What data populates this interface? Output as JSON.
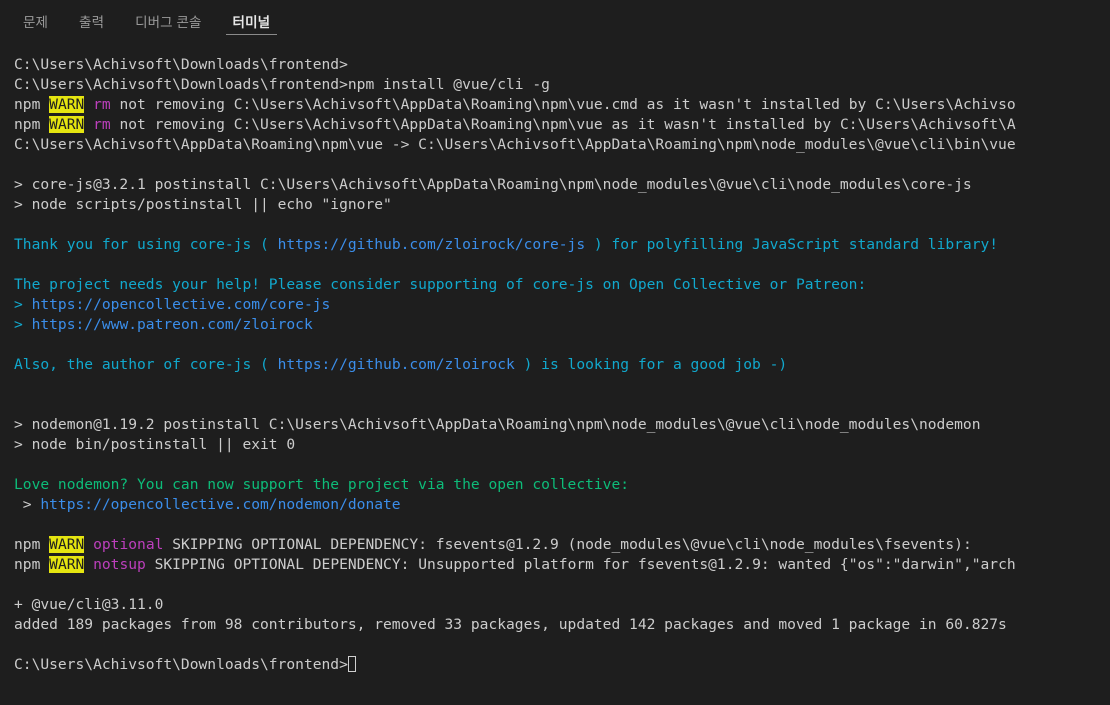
{
  "panel": {
    "tabs": [
      {
        "label": "문제",
        "active": false
      },
      {
        "label": "출력",
        "active": false
      },
      {
        "label": "디버그 콘솔",
        "active": false
      },
      {
        "label": "터미널",
        "active": true
      }
    ]
  },
  "colors": {
    "background": "#1e1e1e",
    "foreground": "#cccccc",
    "cyan": "#11a8cd",
    "blue": "#3b8eea",
    "green": "#0dbc79",
    "magenta": "#bc3fbc",
    "warn_background": "#e5e510",
    "warn_foreground": "#1e1e1e",
    "tab_active": "#e7e7e7",
    "tab_inactive": "#9a9a9a"
  },
  "terminal": {
    "prompt": "C:\\Users\\Achivsoft\\Downloads\\frontend>",
    "command": "npm install @vue/cli -g",
    "cursor": "block-outline",
    "lines": [
      {
        "id": "l00",
        "type": "blank"
      },
      {
        "id": "l01",
        "segments": [
          {
            "text": "C:\\Users\\Achivsoft\\Downloads\\frontend>",
            "style": "default"
          }
        ]
      },
      {
        "id": "l02",
        "segments": [
          {
            "text": "C:\\Users\\Achivsoft\\Downloads\\frontend>npm install @vue/cli -g",
            "style": "default"
          }
        ]
      },
      {
        "id": "l03",
        "segments": [
          {
            "text": "npm ",
            "style": "default"
          },
          {
            "text": "WARN",
            "style": "warn"
          },
          {
            "text": " ",
            "style": "default"
          },
          {
            "text": "rm",
            "style": "magenta"
          },
          {
            "text": " not removing C:\\Users\\Achivsoft\\AppData\\Roaming\\npm\\vue.cmd as it wasn't installed by C:\\Users\\Achivso",
            "style": "default"
          }
        ]
      },
      {
        "id": "l04",
        "segments": [
          {
            "text": "npm ",
            "style": "default"
          },
          {
            "text": "WARN",
            "style": "warn"
          },
          {
            "text": " ",
            "style": "default"
          },
          {
            "text": "rm",
            "style": "magenta"
          },
          {
            "text": " not removing C:\\Users\\Achivsoft\\AppData\\Roaming\\npm\\vue as it wasn't installed by C:\\Users\\Achivsoft\\A",
            "style": "default"
          }
        ]
      },
      {
        "id": "l05",
        "segments": [
          {
            "text": "C:\\Users\\Achivsoft\\AppData\\Roaming\\npm\\vue -> C:\\Users\\Achivsoft\\AppData\\Roaming\\npm\\node_modules\\@vue\\cli\\bin\\vue",
            "style": "default"
          }
        ]
      },
      {
        "id": "l06",
        "type": "blank"
      },
      {
        "id": "l07",
        "segments": [
          {
            "text": "> core-js@3.2.1 postinstall C:\\Users\\Achivsoft\\AppData\\Roaming\\npm\\node_modules\\@vue\\cli\\node_modules\\core-js",
            "style": "default"
          }
        ]
      },
      {
        "id": "l08",
        "segments": [
          {
            "text": "> node scripts/postinstall || echo \"ignore\"",
            "style": "default"
          }
        ]
      },
      {
        "id": "l09",
        "type": "blank"
      },
      {
        "id": "l10",
        "segments": [
          {
            "text": "Thank you for using core-js ( ",
            "style": "cyan"
          },
          {
            "text": "https://github.com/zloirock/core-js",
            "style": "blue"
          },
          {
            "text": " ) for polyfilling JavaScript standard library!",
            "style": "cyan"
          }
        ]
      },
      {
        "id": "l11",
        "type": "blank"
      },
      {
        "id": "l12",
        "segments": [
          {
            "text": "The project needs your help! Please consider supporting of core-js on Open Collective or Patreon:",
            "style": "cyan"
          }
        ]
      },
      {
        "id": "l13",
        "segments": [
          {
            "text": "> ",
            "style": "cyan"
          },
          {
            "text": "https://opencollective.com/core-js",
            "style": "blue"
          }
        ]
      },
      {
        "id": "l14",
        "segments": [
          {
            "text": "> ",
            "style": "cyan"
          },
          {
            "text": "https://www.patreon.com/zloirock",
            "style": "blue"
          }
        ]
      },
      {
        "id": "l15",
        "type": "blank"
      },
      {
        "id": "l16",
        "segments": [
          {
            "text": "Also, the author of core-js ( ",
            "style": "cyan"
          },
          {
            "text": "https://github.com/zloirock",
            "style": "blue"
          },
          {
            "text": " ) is looking for a good job -)",
            "style": "cyan"
          }
        ]
      },
      {
        "id": "l17",
        "type": "blank"
      },
      {
        "id": "l18",
        "type": "blank"
      },
      {
        "id": "l19",
        "segments": [
          {
            "text": "> nodemon@1.19.2 postinstall C:\\Users\\Achivsoft\\AppData\\Roaming\\npm\\node_modules\\@vue\\cli\\node_modules\\nodemon",
            "style": "default"
          }
        ]
      },
      {
        "id": "l20",
        "segments": [
          {
            "text": "> node bin/postinstall || exit 0",
            "style": "default"
          }
        ]
      },
      {
        "id": "l21",
        "type": "blank"
      },
      {
        "id": "l22",
        "segments": [
          {
            "text": "Love nodemon? You can now support the project via the open collective:",
            "style": "green"
          }
        ]
      },
      {
        "id": "l23",
        "segments": [
          {
            "text": " > ",
            "style": "default"
          },
          {
            "text": "https://opencollective.com/nodemon/donate",
            "style": "blue"
          }
        ]
      },
      {
        "id": "l24",
        "type": "blank"
      },
      {
        "id": "l25",
        "segments": [
          {
            "text": "npm ",
            "style": "default"
          },
          {
            "text": "WARN",
            "style": "warn"
          },
          {
            "text": " ",
            "style": "default"
          },
          {
            "text": "optional",
            "style": "magenta"
          },
          {
            "text": " SKIPPING OPTIONAL DEPENDENCY: fsevents@1.2.9 (node_modules\\@vue\\cli\\node_modules\\fsevents):",
            "style": "default"
          }
        ]
      },
      {
        "id": "l26",
        "segments": [
          {
            "text": "npm ",
            "style": "default"
          },
          {
            "text": "WARN",
            "style": "warn"
          },
          {
            "text": " ",
            "style": "default"
          },
          {
            "text": "notsup",
            "style": "magenta"
          },
          {
            "text": " SKIPPING OPTIONAL DEPENDENCY: Unsupported platform for fsevents@1.2.9: wanted {\"os\":\"darwin\",\"arch",
            "style": "default"
          }
        ]
      },
      {
        "id": "l27",
        "type": "blank"
      },
      {
        "id": "l28",
        "segments": [
          {
            "text": "+ @vue/cli@3.11.0",
            "style": "default"
          }
        ]
      },
      {
        "id": "l29",
        "segments": [
          {
            "text": "added 189 packages from 98 contributors, removed 33 packages, updated 142 packages and moved 1 package in 60.827s",
            "style": "default"
          }
        ]
      },
      {
        "id": "l30",
        "type": "blank"
      },
      {
        "id": "l31",
        "type": "prompt",
        "segments": [
          {
            "text": "C:\\Users\\Achivsoft\\Downloads\\frontend>",
            "style": "default"
          }
        ]
      }
    ]
  }
}
